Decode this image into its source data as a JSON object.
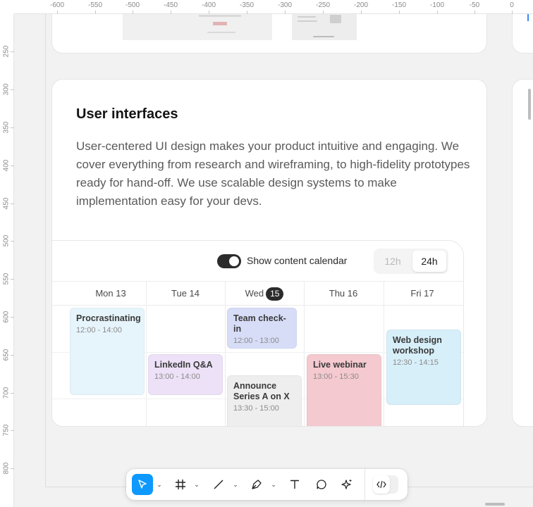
{
  "rulers": {
    "top": [
      "-600",
      "-550",
      "-500",
      "-450",
      "-400",
      "-350",
      "-300",
      "-250",
      "-200",
      "-150",
      "-100",
      "-50",
      "0"
    ],
    "left": [
      "250",
      "300",
      "350",
      "400",
      "450",
      "500",
      "550",
      "600",
      "650",
      "700",
      "750",
      "800"
    ]
  },
  "card": {
    "title": "User interfaces",
    "description": "User-centered UI design makes your product intuitive and engaging. We cover everything from research and wireframing, to high-fidelity prototypes ready for hand-off. We use scalable design systems to make implementation easy for your devs."
  },
  "calendar": {
    "toggle_label": "Show content calendar",
    "toggle_on": true,
    "time_formats": [
      "12h",
      "24h"
    ],
    "selected_format": "24h",
    "days": [
      {
        "label": "Mon 13"
      },
      {
        "label": "Tue 14"
      },
      {
        "label": "Wed",
        "badge": "15"
      },
      {
        "label": "Thu 16"
      },
      {
        "label": "Fri 17"
      }
    ],
    "events": [
      {
        "title": "Procrastinating",
        "time": "12:00 - 14:00",
        "day": "Mon 13",
        "color": "#e6f4fb"
      },
      {
        "title": "LinkedIn Q&A",
        "time": "13:00 - 14:00",
        "day": "Tue 14",
        "color": "#ece1f7"
      },
      {
        "title": "Team check-in",
        "time": "12:00 - 13:00",
        "day": "Wed 15",
        "color": "#d7ddf7"
      },
      {
        "title": "Announce Series A on X",
        "time": "13:30 - 15:00",
        "day": "Wed 15",
        "color": "#eeeeee"
      },
      {
        "title": "Live webinar",
        "time": "13:00 - 15:30",
        "day": "Thu 16",
        "color": "#f4c9cf"
      },
      {
        "title": "Web design workshop",
        "time": "12:30 - 14:15",
        "day": "Fri 17",
        "color": "#d7eff9"
      }
    ]
  },
  "toolbar": {
    "tools": [
      {
        "name": "move-tool",
        "icon": "cursor-arrow-icon",
        "active": true
      },
      {
        "name": "frame-tool",
        "icon": "hash-frame-icon",
        "active": false
      },
      {
        "name": "line-tool",
        "icon": "line-icon",
        "active": false
      },
      {
        "name": "pen-tool",
        "icon": "pen-nib-icon",
        "active": false
      },
      {
        "name": "text-tool",
        "icon": "text-T-icon",
        "active": false
      },
      {
        "name": "comment-tool",
        "icon": "speech-bubble-icon",
        "active": false
      },
      {
        "name": "actions-tool",
        "icon": "sparkle-icon",
        "active": false
      },
      {
        "name": "dev-mode-toggle",
        "icon": "code-brackets-icon",
        "active": false
      }
    ],
    "accent": "#0d99ff"
  }
}
